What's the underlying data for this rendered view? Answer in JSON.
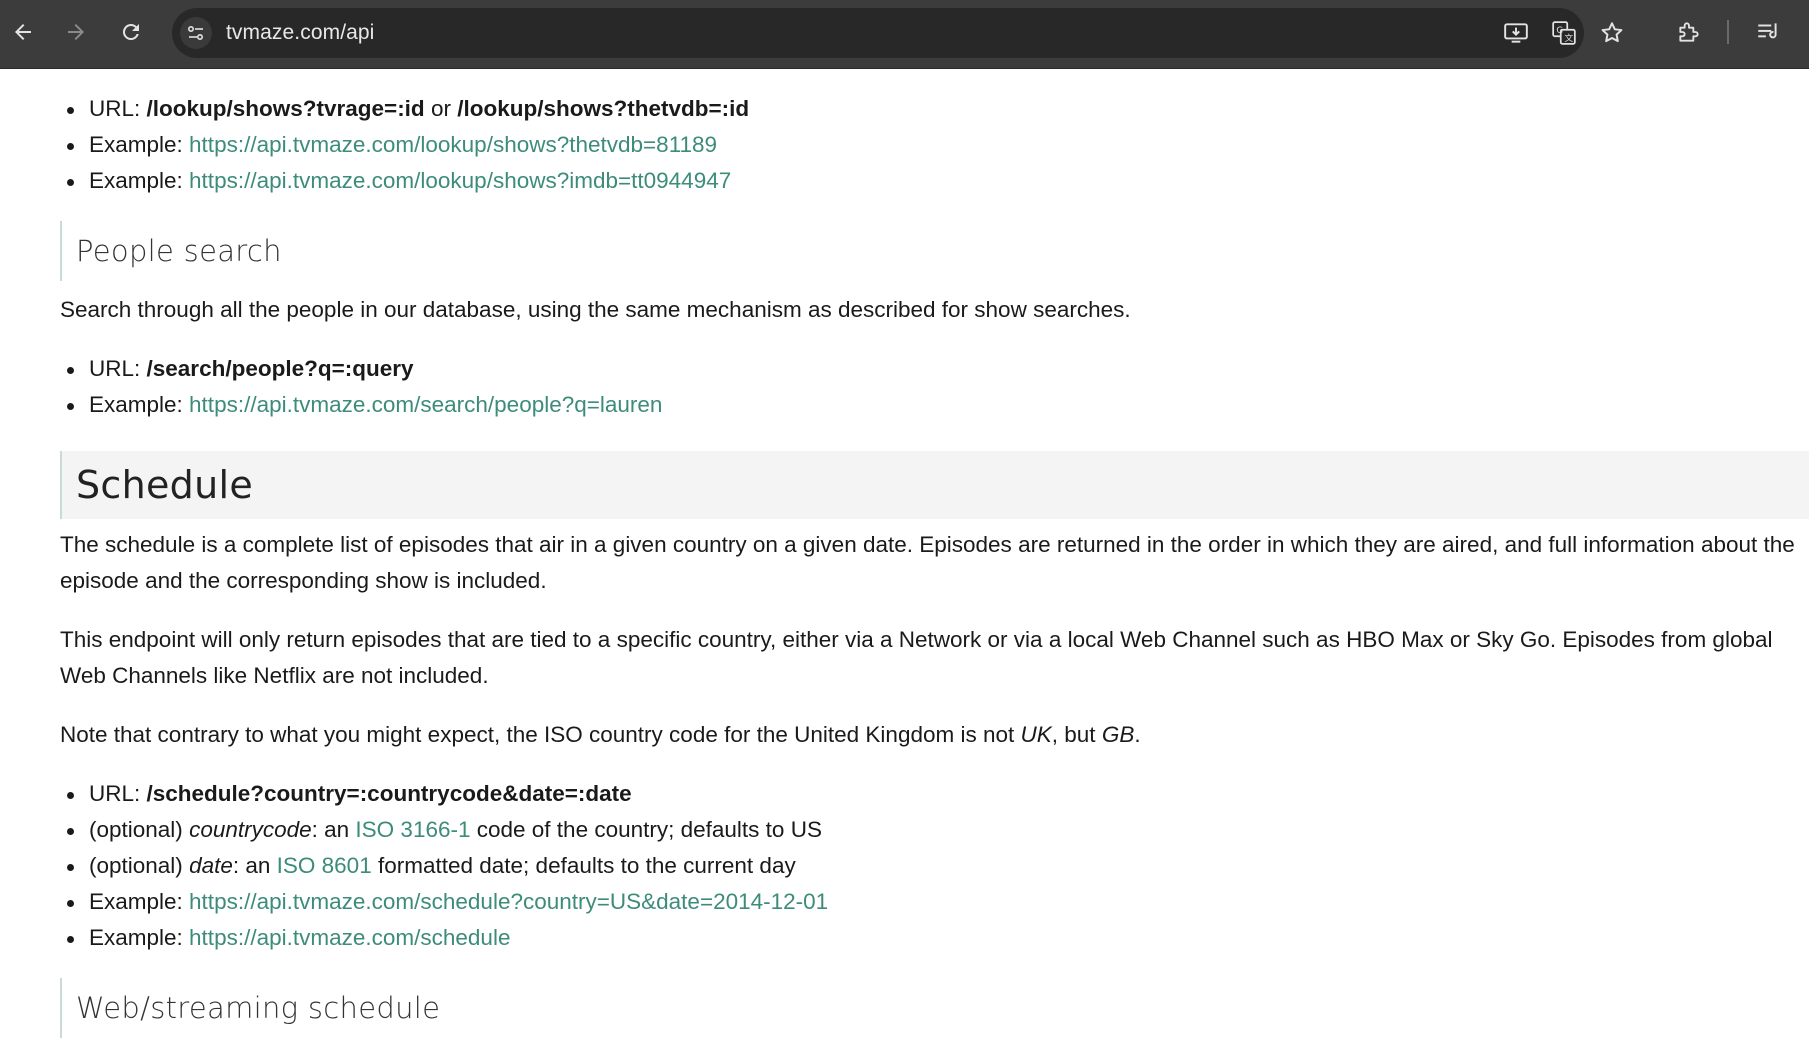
{
  "browser": {
    "url": "tvmaze.com/api",
    "icons": [
      "back-arrow-icon",
      "forward-arrow-icon",
      "reload-icon",
      "site-info-icon",
      "install-app-icon",
      "translate-icon",
      "bookmark-star-icon",
      "extensions-puzzle-icon",
      "reading-list-icon"
    ]
  },
  "lookup": {
    "url_label": "URL: ",
    "url_code_1": "/lookup/shows?tvrage=:id",
    "url_or": " or ",
    "url_code_2": "/lookup/shows?thetvdb=:id",
    "example_label": "Example: ",
    "example_1": "https://api.tvmaze.com/lookup/shows?thetvdb=81189",
    "example_2": "https://api.tvmaze.com/lookup/shows?imdb=tt0944947"
  },
  "people_search": {
    "heading": "People search",
    "description": "Search through all the people in our database, using the same mechanism as described for show searches.",
    "url_label": "URL: ",
    "url_code": "/search/people?q=:query",
    "example_label": "Example: ",
    "example": "https://api.tvmaze.com/search/people?q=lauren"
  },
  "schedule": {
    "heading": "Schedule",
    "para_1": "The schedule is a complete list of episodes that air in a given country on a given date. Episodes are returned in the order in which they are aired, and full information about the episode and the corresponding show is included.",
    "para_2": "This endpoint will only return episodes that are tied to a specific country, either via a Network or via a local Web Channel such as HBO Max or Sky Go. Episodes from global Web Channels like Netflix are not included.",
    "para_3_a": "Note that contrary to what you might expect, the ISO country code for the United Kingdom is not ",
    "para_3_uk": "UK",
    "para_3_b": ", but ",
    "para_3_gb": "GB",
    "para_3_c": ".",
    "url_label": "URL: ",
    "url_code": "/schedule?country=:countrycode&date=:date",
    "optional_label": "(optional) ",
    "countrycode_param": "countrycode",
    "countrycode_mid": ": an ",
    "countrycode_link": "ISO 3166-1",
    "countrycode_tail": " code of the country; defaults to US",
    "date_param": "date",
    "date_mid": ": an ",
    "date_link": "ISO 8601",
    "date_tail": " formatted date; defaults to the current day",
    "example_label": "Example: ",
    "example_1": "https://api.tvmaze.com/schedule?country=US&date=2014-12-01",
    "example_2": "https://api.tvmaze.com/schedule"
  },
  "web_schedule": {
    "heading": "Web/streaming schedule"
  }
}
